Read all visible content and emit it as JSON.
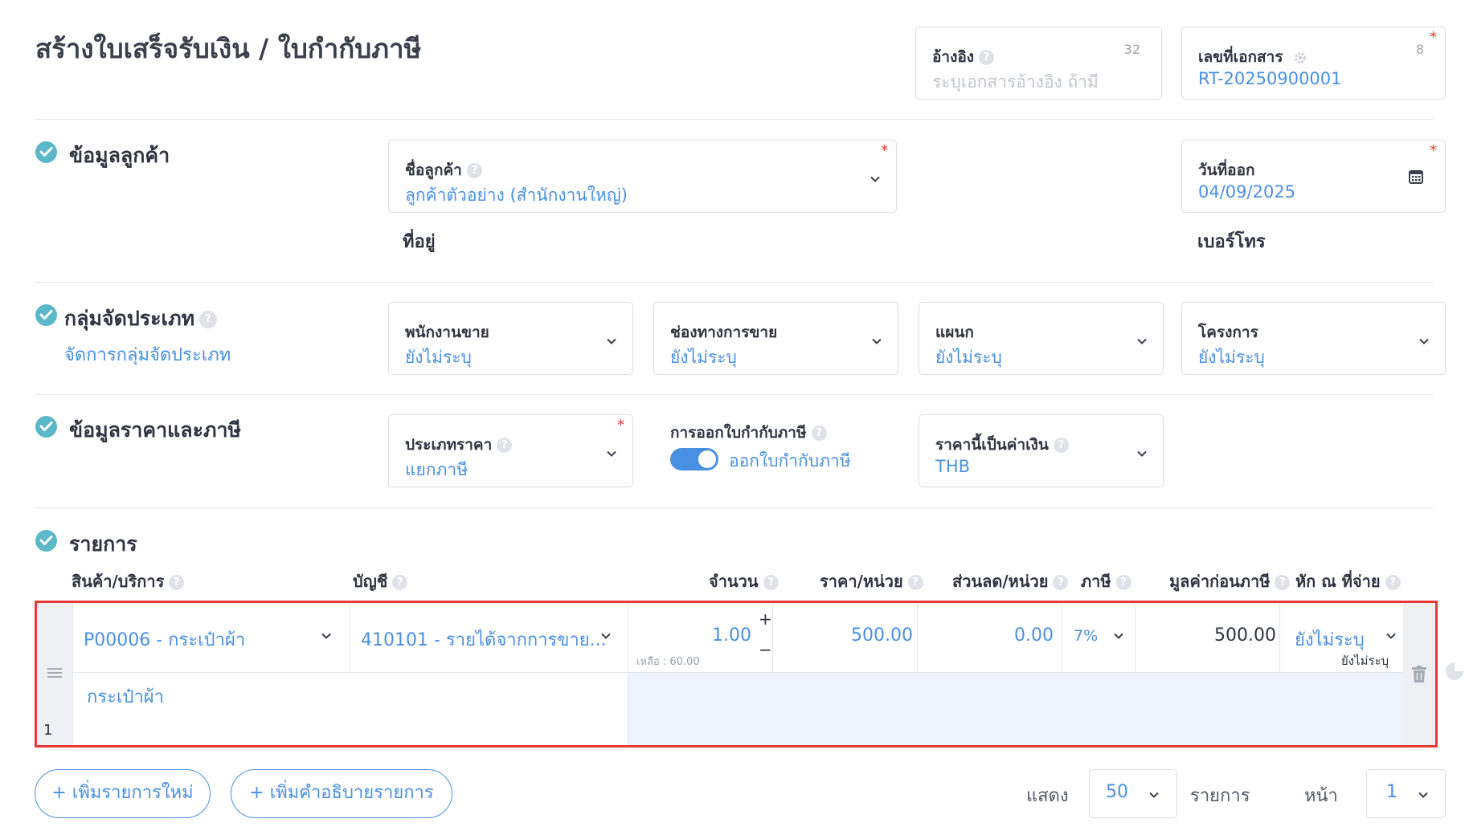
{
  "page": {
    "title": "สร้างใบเสร็จรับเงิน / ใบกำกับภาษี"
  },
  "reference": {
    "label": "อ้างอิง",
    "placeholder": "ระบุเอกสารอ้างอิง ถ้ามี",
    "count": "32"
  },
  "doc_number": {
    "label": "เลขที่เอกสาร",
    "value": "RT-20250900001",
    "count": "8",
    "required": "*"
  },
  "customer_section": {
    "title": "ข้อมูลลูกค้า",
    "customer_label": "ชื่อลูกค้า",
    "customer_value": "ลูกค้าตัวอย่าง (สำนักงานใหญ่)",
    "required": "*",
    "address_label": "ที่อยู่",
    "issue_date_label": "วันที่ออก",
    "issue_date_value": "04/09/2025",
    "phone_label": "เบอร์โทร"
  },
  "group_section": {
    "title": "กลุ่มจัดประเภท",
    "manage_link": "จัดการกลุ่มจัดประเภท",
    "fields": [
      {
        "label": "พนักงานขาย",
        "value": "ยังไม่ระบุ"
      },
      {
        "label": "ช่องทางการขาย",
        "value": "ยังไม่ระบุ"
      },
      {
        "label": "แผนก",
        "value": "ยังไม่ระบุ"
      },
      {
        "label": "โครงการ",
        "value": "ยังไม่ระบุ"
      }
    ]
  },
  "price_section": {
    "title": "ข้อมูลราคาและภาษี",
    "price_type_label": "ประเภทราคา",
    "price_type_value": "แยกภาษี",
    "required": "*",
    "tax_invoice_label": "การออกใบกำกับภาษี",
    "tax_invoice_toggle_label": "ออกใบกำกับภาษี",
    "tax_invoice_on": true,
    "currency_label": "ราคานี้เป็นค่าเงิน",
    "currency_value": "THB"
  },
  "items_section": {
    "title": "รายการ",
    "columns": [
      "สินค้า/บริการ",
      "บัญชี",
      "จำนวน",
      "ราคา/หน่วย",
      "ส่วนลด/หน่วย",
      "ภาษี",
      "มูลค่าก่อนภาษี",
      "หัก ณ ที่จ่าย"
    ],
    "rows": [
      {
        "index": "1",
        "product": "P00006 - กระเป๋าผ้า",
        "account": "410101 - รายได้จากการขาย...",
        "quantity": "1.00",
        "remaining": "เหลือ : 60.00",
        "unit_price": "500.00",
        "discount": "0.00",
        "tax": "7%",
        "pre_tax_amount": "500.00",
        "withholding": "ยังไม่ระบุ",
        "withholding_sub": "ยังไม่ระบุ",
        "description": "กระเป๋าผ้า"
      }
    ],
    "plus": "+",
    "minus": "−"
  },
  "actions": {
    "add_item": "+ เพิ่มรายการใหม่",
    "add_description": "+ เพิ่มคำอธิบายรายการ"
  },
  "pagination": {
    "show_label": "แสดง",
    "per_page": "50",
    "items_label": "รายการ",
    "page_label": "หน้า",
    "page": "1"
  },
  "colors": {
    "accent": "#4a90e2",
    "check": "#5bb8c9",
    "required": "#e53935",
    "highlight_border": "#e53935",
    "row_fill": "#edf4fd"
  }
}
